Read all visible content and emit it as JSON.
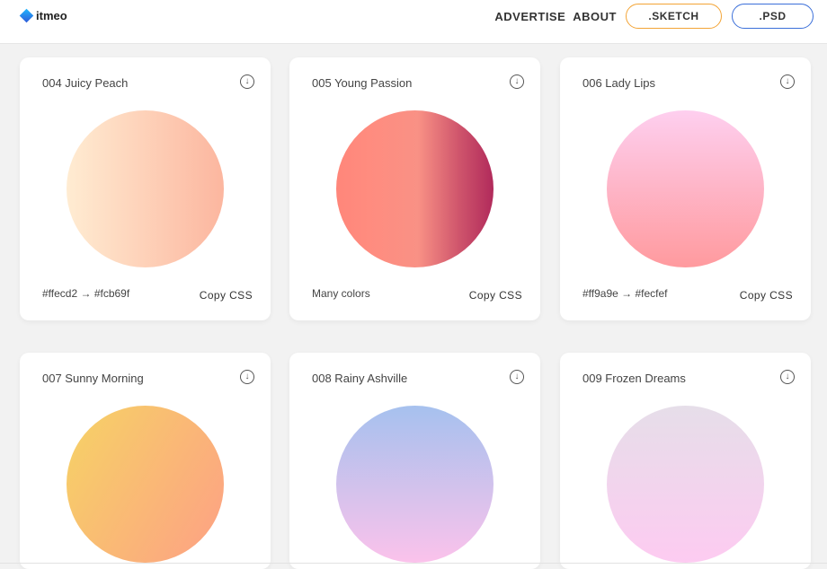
{
  "header": {
    "logo": "itmeo",
    "nav": [
      "ADVERTISE",
      "ABOUT"
    ],
    "sketch_button": ".SKETCH",
    "psd_button": ".PSD"
  },
  "cards": [
    {
      "title": "004 Juicy Peach",
      "info": "#ffecd2 → #fcb69f",
      "copy": "Copy CSS",
      "gradient": "linear-gradient(to right,#ffecd2,#fcb69f)"
    },
    {
      "title": "005 Young Passion",
      "info": "Many colors",
      "copy": "Copy CSS",
      "gradient": "linear-gradient(to right,#ff8177 0%,#ff867a 0%,#ff8c7f 21%,#f99185 52%,#cf556c 78%,#b12a5b 100%)"
    },
    {
      "title": "006 Lady Lips",
      "info": "#ff9a9e → #fecfef",
      "copy": "Copy CSS",
      "gradient": "linear-gradient(to top,#ff9a9e,#fecfef)"
    },
    {
      "title": "007 Sunny Morning",
      "info": "",
      "copy": "",
      "gradient": "linear-gradient(120deg,#f6d365,#fda085)"
    },
    {
      "title": "008 Rainy Ashville",
      "info": "",
      "copy": "",
      "gradient": "linear-gradient(to top,#fbc2eb,#a6c1ee)"
    },
    {
      "title": "009 Frozen Dreams",
      "info": "",
      "copy": "",
      "gradient": "linear-gradient(to top,#fdcbf1,#e6dee9)"
    }
  ],
  "icons": {
    "download": "download-circle-icon"
  }
}
